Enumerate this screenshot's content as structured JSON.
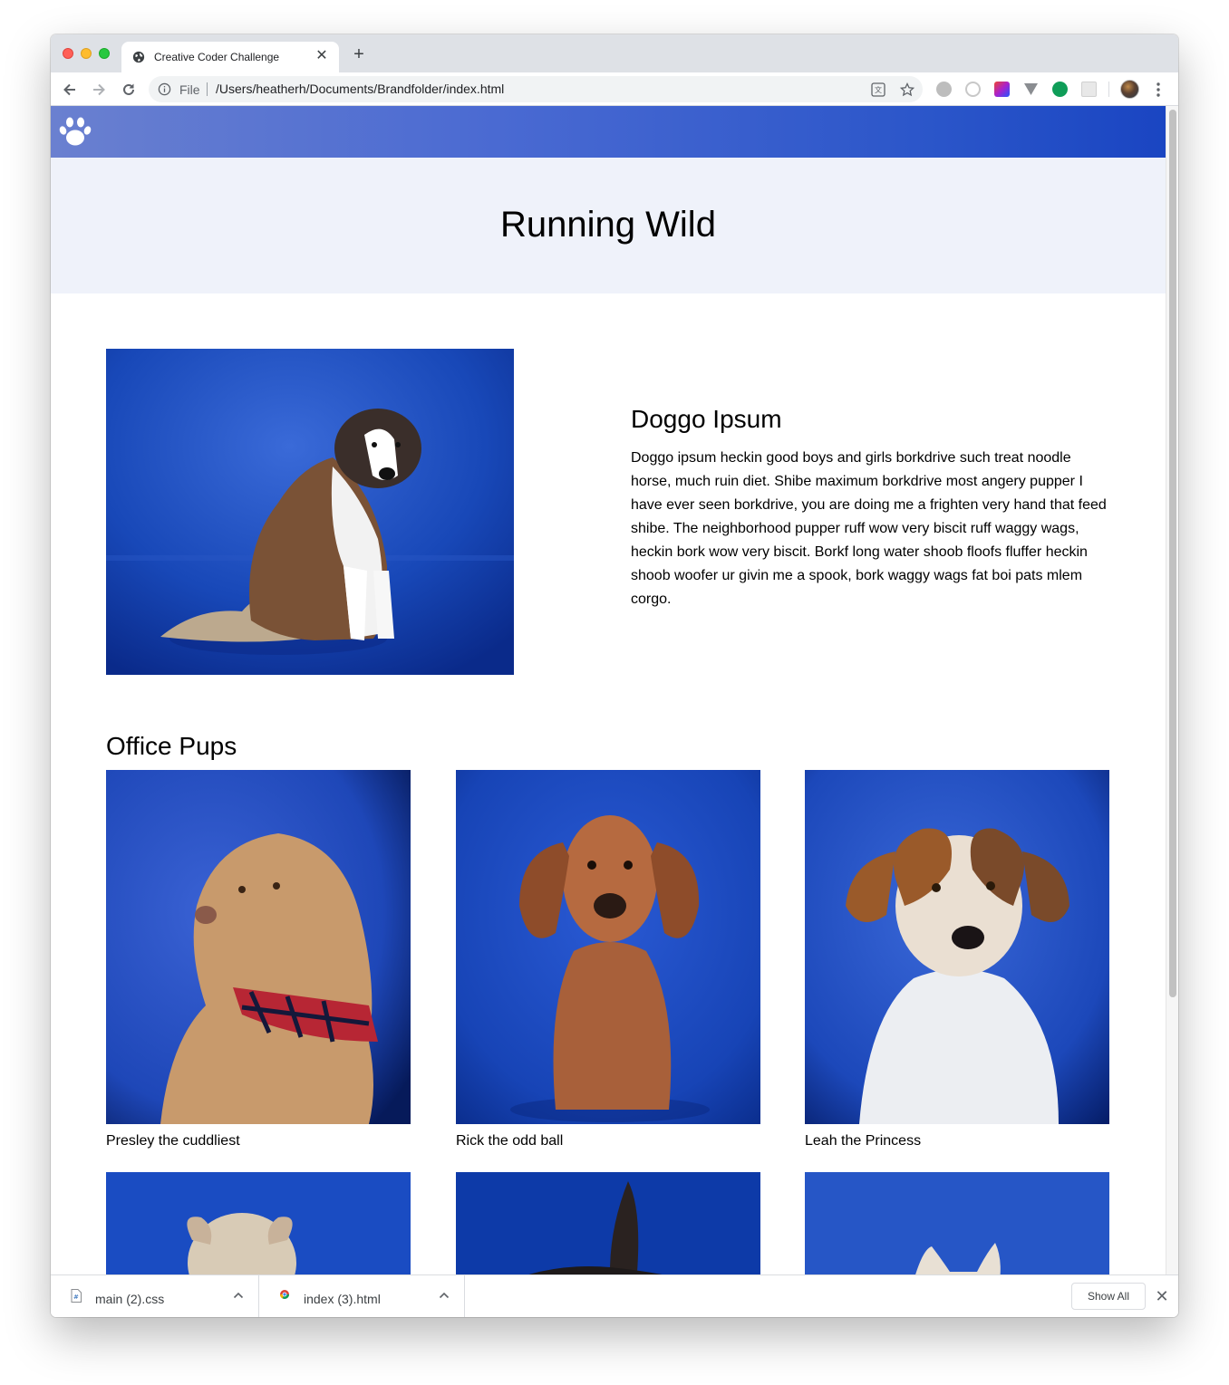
{
  "browser": {
    "tab_title": "Creative Coder Challenge",
    "tab_close": "✕",
    "new_tab": "+",
    "file_label": "File",
    "url": "/Users/heatherh/Documents/Brandfolder/index.html"
  },
  "site": {
    "logo_icon": "paw-icon",
    "hero_title": "Running Wild",
    "feature": {
      "heading": "Doggo Ipsum",
      "body": "Doggo ipsum heckin good boys and girls borkdrive such treat noodle horse, much ruin diet. Shibe maximum borkdrive most angery pupper I have ever seen borkdrive, you are doing me a frighten very hand that feed shibe. The neighborhood pupper ruff wow very biscit ruff waggy wags, heckin bork wow very biscit. Borkf long water shoob floofs fluffer heckin shoob woofer ur givin me a spook, bork waggy wags fat boi pats mlem corgo."
    },
    "section_title": "Office Pups",
    "pups": [
      {
        "name": "Presley the cuddliest"
      },
      {
        "name": "Rick the odd ball"
      },
      {
        "name": "Leah the Princess"
      }
    ]
  },
  "downloads": {
    "items": [
      {
        "name": "main (2).css"
      },
      {
        "name": "index (3).html"
      }
    ],
    "show_all": "Show All",
    "close": "✕"
  },
  "colors": {
    "header_gradient_start": "#6a80d0",
    "header_gradient_end": "#1a45c2",
    "hero_bg": "#eff2fa",
    "photo_backdrop": "#1a4dc4"
  }
}
